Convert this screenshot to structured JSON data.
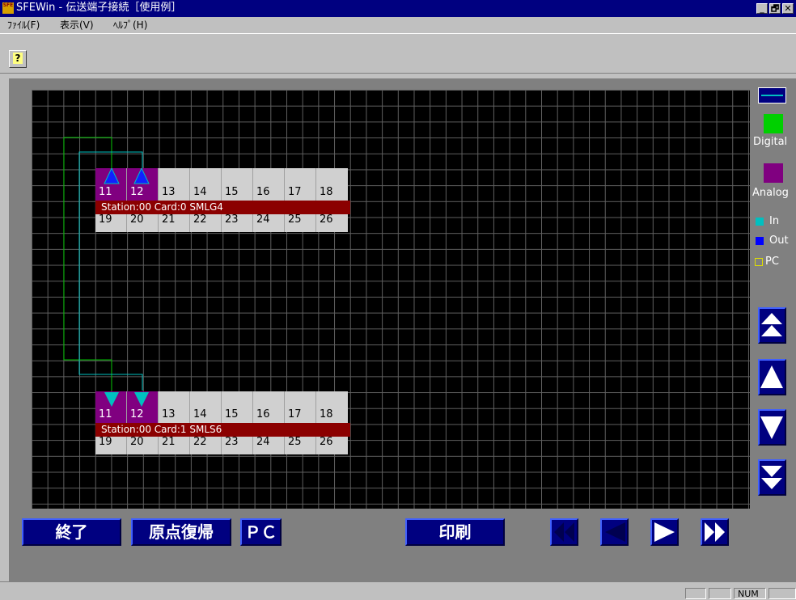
{
  "window": {
    "title": "SFEWin - 伝送端子接続［使用例］",
    "app_icon_label": "SFE",
    "controls": {
      "minimize": "_",
      "maximize": "🗗",
      "close": "✕"
    }
  },
  "menu": {
    "items": [
      {
        "label": "ﾌｧｲﾙ(F)"
      },
      {
        "label": "表示(V)"
      },
      {
        "label": "ﾍﾙﾌﾟ(H)"
      }
    ]
  },
  "toolbar": {
    "help_glyph": "?"
  },
  "legend": {
    "digital_label": "Digital",
    "analog_label": "Analog",
    "in_label": "In",
    "out_label": "Out",
    "pc_label": "PC",
    "colors": {
      "line": "#00c0c0",
      "digital": "#00d000",
      "analog": "#800080",
      "in": "#00c0c0",
      "out": "#0000ff",
      "pc": "#e0e000"
    }
  },
  "cards": [
    {
      "station_label": "Station:00   Card:0   SMLG4",
      "top_terminals": [
        "11",
        "12",
        "13",
        "14",
        "15",
        "16",
        "17",
        "18"
      ],
      "bottom_terminals": [
        "19",
        "20",
        "21",
        "22",
        "23",
        "24",
        "25",
        "26"
      ],
      "connected": [
        "11",
        "12"
      ],
      "direction": "out"
    },
    {
      "station_label": "Station:00   Card:1   SMLS6",
      "top_terminals": [
        "11",
        "12",
        "13",
        "14",
        "15",
        "16",
        "17",
        "18"
      ],
      "bottom_terminals": [
        "19",
        "20",
        "21",
        "22",
        "23",
        "24",
        "25",
        "26"
      ],
      "connected": [
        "11",
        "12"
      ],
      "direction": "in"
    }
  ],
  "buttons": {
    "exit_label": "終了",
    "origin_label": "原点復帰",
    "pc_label": "ＰＣ",
    "print_label": "印刷"
  },
  "statusbar": {
    "num_label": "NUM"
  }
}
